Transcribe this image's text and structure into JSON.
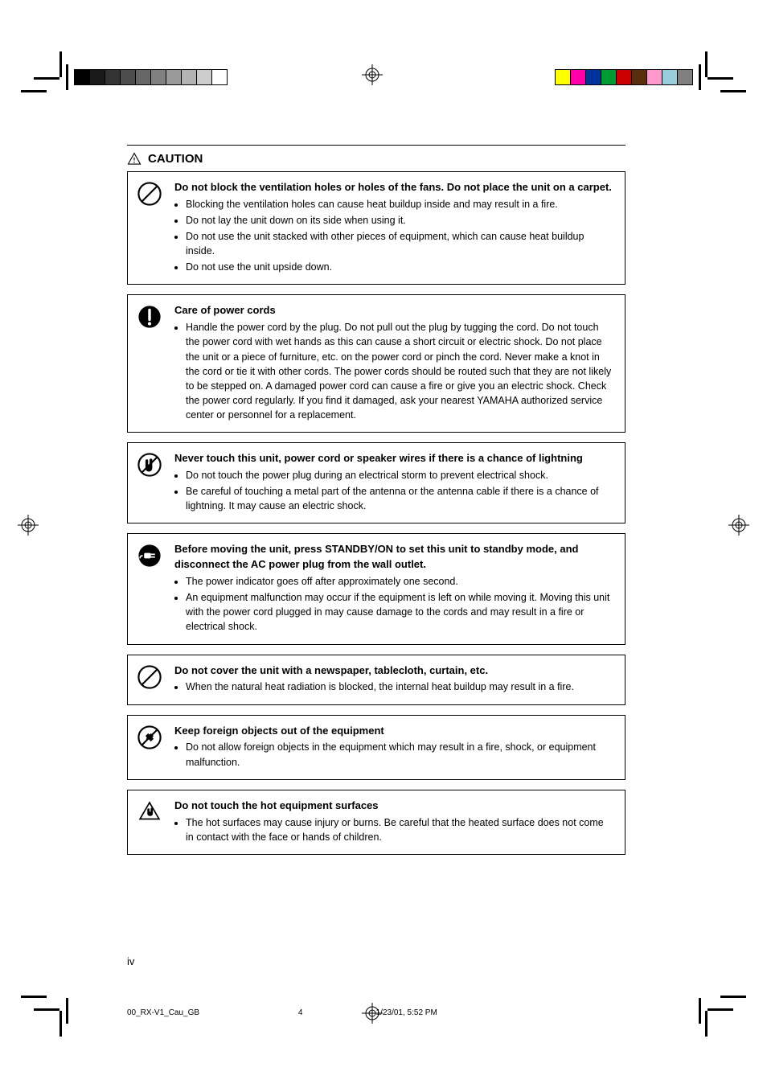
{
  "header": {
    "caution_label": "CAUTION"
  },
  "boxes": [
    {
      "title": "Do not block the ventilation holes or holes of the fans. Do not place the unit on a carpet.",
      "bullets": [
        "Blocking the ventilation holes can cause heat buildup inside and may result in a fire.",
        "Do not lay the unit down on its side when using it.",
        "Do not use the unit stacked with other pieces of equipment, which can cause heat buildup inside.",
        "Do not use the unit upside down."
      ]
    },
    {
      "title": "Care of power cords",
      "bullets": [
        "Handle the power cord by the plug. Do not pull out the plug by tugging the cord. Do not touch the power cord with wet hands as this can cause a short circuit or electric shock. Do not place the unit or a piece of furniture, etc. on the power cord or pinch the cord. Never make a knot in the cord or tie it with other cords. The power cords should be routed such that they are not likely to be stepped on. A damaged power cord can cause a fire or give you an electric shock. Check the power cord regularly. If you find it damaged, ask your nearest YAMAHA authorized service center or personnel for a replacement."
      ]
    },
    {
      "title": "Never touch this unit, power cord or speaker wires if there is a chance of lightning",
      "bullets": [
        "Do not touch the power plug during an electrical storm to prevent electrical shock.",
        "Be careful of touching a metal part of the antenna or the antenna cable if there is a chance of lightning. It may cause an electric shock."
      ]
    },
    {
      "title": "Before moving the unit, press STANDBY/ON to set this unit to standby mode, and disconnect the AC power plug from the wall outlet.",
      "bullets": [
        "The power indicator goes off after approximately one second.",
        "An equipment malfunction may occur if the equipment is left on while moving it. Moving this unit with the power cord plugged in may cause damage to the cords and may result in a fire or electrical shock."
      ]
    },
    {
      "title": "Do not cover the unit with a newspaper, tablecloth, curtain, etc.",
      "bullets": [
        "When the natural heat radiation is blocked, the internal heat buildup may result in a fire."
      ]
    },
    {
      "title": "Keep foreign objects out of the equipment",
      "bullets": [
        "Do not allow foreign objects in the equipment which may result in a fire, shock, or equipment malfunction."
      ]
    },
    {
      "title": "Do not touch the hot equipment surfaces",
      "bullets": [
        "The hot surfaces may cause injury or burns. Be careful that the heated surface does not come in contact with the face or hands of children."
      ]
    }
  ],
  "footer": {
    "page_number": "iv",
    "slug_file": "00_RX-V1_Cau_GB",
    "slug_page": "4",
    "slug_time": "1/23/01, 5:52 PM"
  }
}
